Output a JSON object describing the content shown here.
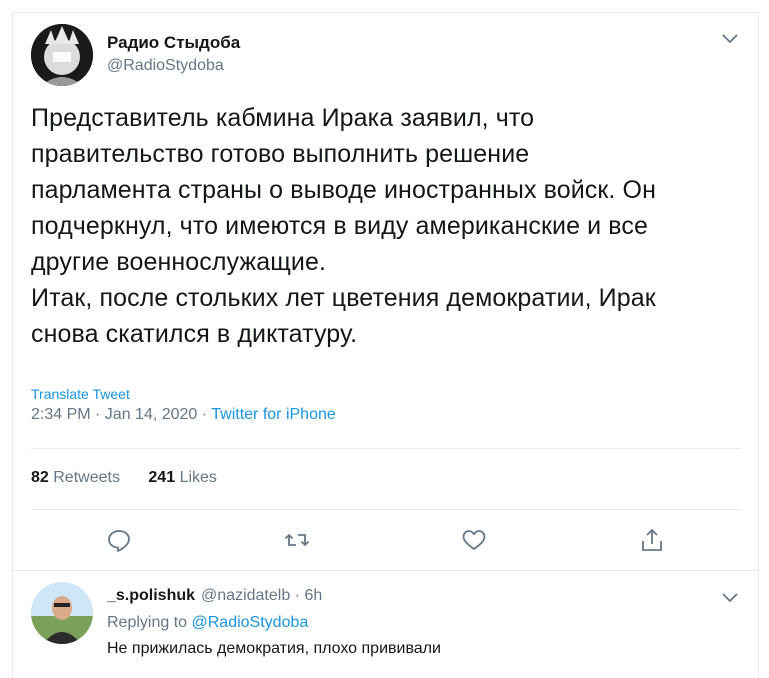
{
  "tweet": {
    "author_name": "Радио Стыдоба",
    "author_handle": "@RadioStydoba",
    "text": "Представитель кабмина Ирака заявил, что\nправительство готово выполнить решение\nпарламента страны о выводе иностранных войск. Он\nподчеркнул, что имеются в виду американские и все\nдругие военнослужащие.\nИтак, после стольких лет цветения демократии, Ирак\nснова скатился в диктатуру.",
    "translate_label": "Translate Tweet",
    "timestamp": "2:34 PM · Jan 14, 2020 · ",
    "source": "Twitter for iPhone",
    "retweets_count": "82",
    "retweets_label": "Retweets",
    "likes_count": "241",
    "likes_label": "Likes"
  },
  "actions": {
    "reply_icon": "reply-icon",
    "retweet_icon": "retweet-icon",
    "like_icon": "heart-icon",
    "share_icon": "share-icon"
  },
  "reply": {
    "author_name": "_s.polishuk",
    "author_handle": "@nazidatelb",
    "time": "· 6h",
    "replying_prefix": "Replying to ",
    "replying_to": "@RadioStydoba",
    "text": "Не прижилась демократия, плохо прививали"
  },
  "colors": {
    "accent": "#1b95e0",
    "secondary_text": "#657786",
    "primary_text": "#14171a",
    "divider": "#e6ecf0"
  }
}
